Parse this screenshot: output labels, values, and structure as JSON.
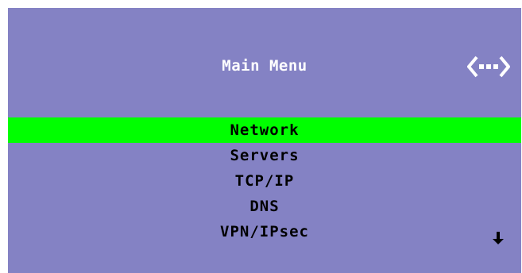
{
  "screen": {
    "title": "Main Menu",
    "menu_items": [
      {
        "label": "Network",
        "selected": true
      },
      {
        "label": "Servers",
        "selected": false
      },
      {
        "label": "TCP/IP",
        "selected": false
      },
      {
        "label": "DNS",
        "selected": false
      },
      {
        "label": "VPN/IPsec",
        "selected": false
      }
    ],
    "icons": {
      "network": "network-icon",
      "scroll": "arrow-down-icon"
    },
    "colors": {
      "background": "#8482c4",
      "highlight": "#00ff00",
      "title_text": "#ffffff",
      "menu_text": "#000000"
    }
  }
}
